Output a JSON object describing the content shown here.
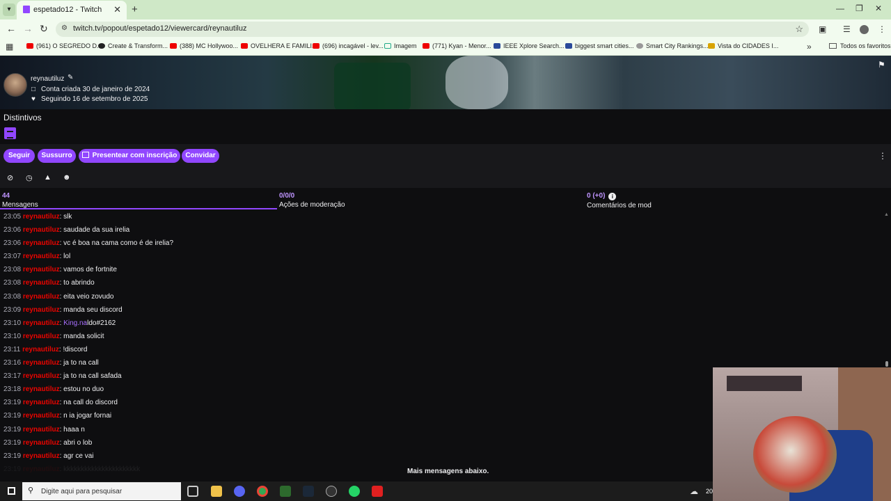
{
  "browser": {
    "tab_title": "espetado12 - Twitch",
    "url": "twitch.tv/popout/espetado12/viewercard/reynautiluz",
    "bookmarks": [
      "(961) O SEGREDO D...",
      "Create & Transform...",
      "(388) MC Hollywoo...",
      "OVELHERA E FAMILI...",
      "(696) incagável - lev...",
      "Imagem",
      "(771) Kyan - Menor...",
      "IEEE Xplore Search...",
      "biggest smart cities...",
      "Smart City Rankings...",
      "Vista do CIDADES I..."
    ],
    "favorites_folder": "Todos os favoritos"
  },
  "user": {
    "name": "reynautiluz",
    "created": "Conta criada 30 de janeiro de 2024",
    "following": "Seguindo 16 de setembro de 2025"
  },
  "badges_title": "Distintivos",
  "actions": {
    "follow": "Seguir",
    "whisper": "Sussurro",
    "gift_sub": "Presentear com inscrição",
    "invite": "Convidar"
  },
  "tabs": [
    {
      "count": "44",
      "label": "Mensagens"
    },
    {
      "count": "0/0/0",
      "label": "Ações de moderação"
    },
    {
      "count": "0 (+0)",
      "label": "Comentários de mod"
    }
  ],
  "messages": [
    {
      "time": "23:05",
      "user": "reynautiluz",
      "text": "slk"
    },
    {
      "time": "23:06",
      "user": "reynautiluz",
      "text": "saudade da sua irelia"
    },
    {
      "time": "23:06",
      "user": "reynautiluz",
      "text": "vc é boa na cama como é de irelia?"
    },
    {
      "time": "23:07",
      "user": "reynautiluz",
      "text": "lol"
    },
    {
      "time": "23:08",
      "user": "reynautiluz",
      "text": "vamos de fortnite"
    },
    {
      "time": "23:08",
      "user": "reynautiluz",
      "text": "to abrindo"
    },
    {
      "time": "23:08",
      "user": "reynautiluz",
      "text": "eita veio zovudo"
    },
    {
      "time": "23:09",
      "user": "reynautiluz",
      "text": "manda seu discord"
    },
    {
      "time": "23:10",
      "user": "reynautiluz",
      "mention": "King.na",
      "text": "ldo#2162"
    },
    {
      "time": "23:10",
      "user": "reynautiluz",
      "text": "manda solicit"
    },
    {
      "time": "23:11",
      "user": "reynautiluz",
      "text": "!discord"
    },
    {
      "time": "23:16",
      "user": "reynautiluz",
      "text": "ja to na call"
    },
    {
      "time": "23:17",
      "user": "reynautiluz",
      "text": "ja to na call safada"
    },
    {
      "time": "23:18",
      "user": "reynautiluz",
      "text": "estou no duo"
    },
    {
      "time": "23:19",
      "user": "reynautiluz",
      "text": "na call do discord"
    },
    {
      "time": "23:19",
      "user": "reynautiluz",
      "text": "n ia jogar fornai"
    },
    {
      "time": "23:19",
      "user": "reynautiluz",
      "text": "haaa n"
    },
    {
      "time": "23:19",
      "user": "reynautiluz",
      "text": "abri o lob"
    },
    {
      "time": "23:19",
      "user": "reynautiluz",
      "text": "agr ce vai"
    },
    {
      "time": "23:19",
      "user": "reynautiluz",
      "text": "kkkkkkkkkkkkkkkkkkkkkk"
    }
  ],
  "more_messages": "Mais mensagens abaixo.",
  "taskbar": {
    "search_placeholder": "Digite aqui para pesquisar",
    "clock_fragment": "20"
  },
  "colors": {
    "accent": "#9147ff",
    "username": "#eb0400",
    "mention": "#a970ff",
    "background": "#0e0e10"
  }
}
